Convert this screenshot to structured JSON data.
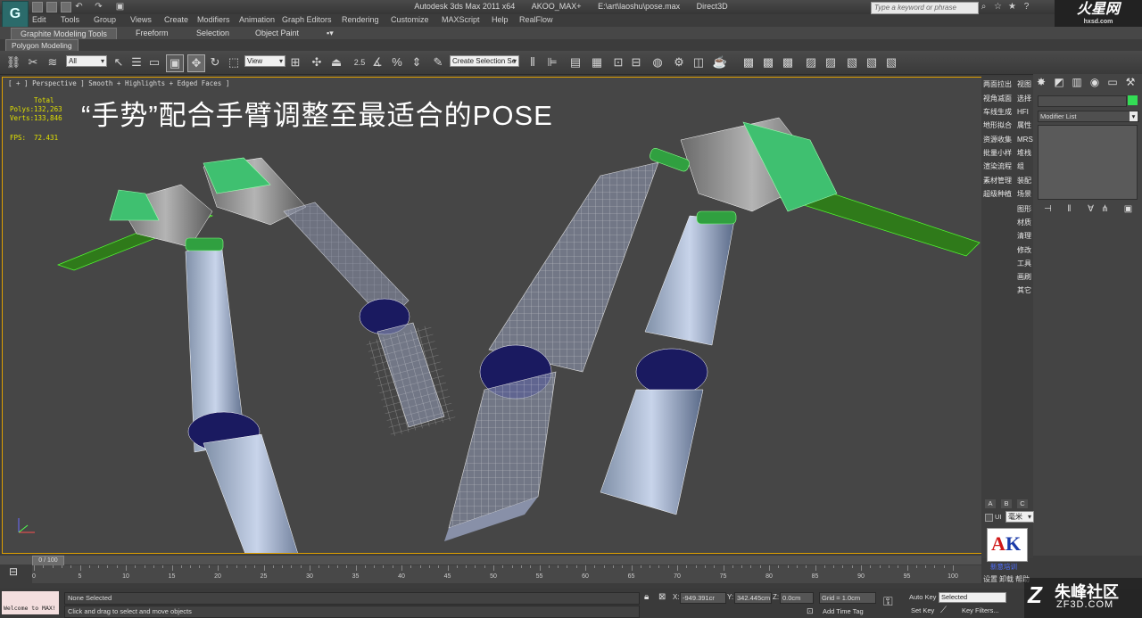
{
  "titlebar": {
    "app_name": "Autodesk 3ds Max  2011 x64",
    "user": "AKOO_MAX+",
    "file_path": "E:\\art\\laoshu\\pose.max",
    "renderer": "Direct3D",
    "search_placeholder": "Type a keyword or phrase"
  },
  "watermark_top": {
    "main": "火星网",
    "sub": "hxsd.com"
  },
  "menu": [
    "Edit",
    "Tools",
    "Group",
    "Views",
    "Create",
    "Modifiers",
    "Animation",
    "Graph Editors",
    "Rendering",
    "Customize",
    "MAXScript",
    "Help",
    "RealFlow"
  ],
  "ribbon": {
    "tabs": [
      "Graphite Modeling Tools",
      "Freeform",
      "Selection",
      "Object Paint"
    ],
    "panel": "Polygon Modeling"
  },
  "toolbar": {
    "filter": "All",
    "ref_coord": "View",
    "named_selection": "Create Selection Se"
  },
  "viewport": {
    "label": "[ + ] Perspective ] Smooth + Highlights + Edged Faces ]",
    "stats": {
      "total_label": "Total",
      "polys_label": "Polys:",
      "polys": "132,263",
      "verts_label": "Verts:",
      "verts": "133,846",
      "fps_label": "FPS:",
      "fps": "72.431"
    },
    "overlay_title": "“手势”配合手臂调整至最适合的POSE"
  },
  "command_tabs_left": [
    "两面拉出",
    "视角减面",
    "车线生成",
    "地形拟合",
    "资源收集",
    "批量小样",
    "渲染流程",
    "素材管理",
    "超级种植"
  ],
  "command_tabs_right": [
    "视图",
    "选择",
    "HFI",
    "属性",
    "MRS",
    "堆栈",
    "组",
    "装配",
    "场景",
    "图形",
    "材质",
    "清理",
    "修改",
    "工具",
    "画刷",
    "其它"
  ],
  "command_panel": {
    "modifier_list": "Modifier List",
    "bottom_tabs": [
      "A",
      "B",
      "C"
    ],
    "ut_label": "UI",
    "unit": "毫米",
    "logo_caption": "新意培训",
    "footer": [
      "设置",
      "卸载",
      "帮助"
    ]
  },
  "timeline": {
    "slider": "0 / 100",
    "ticks": [
      "0",
      "5",
      "10",
      "15",
      "20",
      "25",
      "30",
      "35",
      "40",
      "45",
      "50",
      "55",
      "60",
      "65",
      "70",
      "75",
      "80",
      "85",
      "90",
      "95",
      "100"
    ]
  },
  "status": {
    "maxscript": "Welcome to MAX!",
    "selection": "None Selected",
    "prompt": "Click and drag to select and move objects",
    "x_label": "X:",
    "x": "-949.391cr",
    "y_label": "Y:",
    "y": "342.445cm",
    "z_label": "Z:",
    "z": "0.0cm",
    "grid": "Grid = 1.0cm",
    "add_time_tag": "Add Time Tag",
    "auto_key": "Auto Key",
    "set_key": "Set Key",
    "selected": "Selected",
    "key_filters": "Key Filters..."
  },
  "watermark_bottom": {
    "main": "朱峰社区",
    "sub": "ZF3D.COM"
  }
}
